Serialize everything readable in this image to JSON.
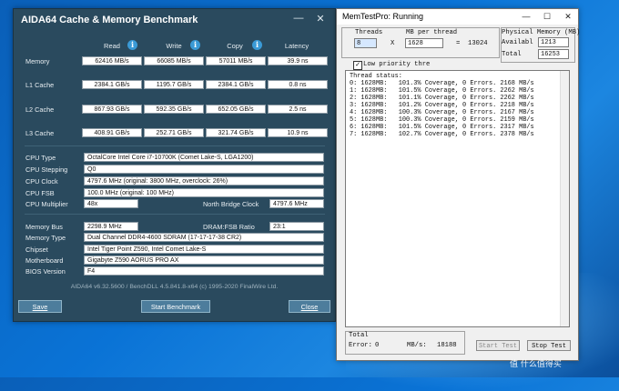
{
  "aida": {
    "title": "AIDA64 Cache & Memory Benchmark",
    "minimize": "—",
    "close": "✕",
    "columns": {
      "read": "Read",
      "write": "Write",
      "copy": "Copy",
      "latency": "Latency"
    },
    "info_glyph": "i",
    "rows": [
      {
        "label": "Memory",
        "read": "62416 MB/s",
        "write": "66085 MB/s",
        "copy": "57011 MB/s",
        "latency": "39.9 ns"
      },
      {
        "label": "L1 Cache",
        "read": "2384.1 GB/s",
        "write": "1195.7 GB/s",
        "copy": "2384.1 GB/s",
        "latency": "0.8 ns"
      },
      {
        "label": "L2 Cache",
        "read": "867.93 GB/s",
        "write": "592.35 GB/s",
        "copy": "652.05 GB/s",
        "latency": "2.5 ns"
      },
      {
        "label": "L3 Cache",
        "read": "408.91 GB/s",
        "write": "252.71 GB/s",
        "copy": "321.74 GB/s",
        "latency": "10.9 ns"
      }
    ],
    "cpu": {
      "type_label": "CPU Type",
      "type": "OctalCore Intel Core i7-10700K  (Comet Lake-S, LGA1200)",
      "stepping_label": "CPU Stepping",
      "stepping": "Q0",
      "clock_label": "CPU Clock",
      "clock": "4797.6 MHz  (original: 3800 MHz, overclock: 26%)",
      "fsb_label": "CPU FSB",
      "fsb": "100.0 MHz  (original: 100 MHz)",
      "multiplier_label": "CPU Multiplier",
      "multiplier": "48x",
      "nb_label": "North Bridge Clock",
      "nb": "4797.6 MHz"
    },
    "mem": {
      "bus_label": "Memory Bus",
      "bus": "2298.9 MHz",
      "ratio_label": "DRAM:FSB Ratio",
      "ratio": "23:1",
      "type_label": "Memory Type",
      "type": "Dual Channel DDR4-4600 SDRAM  (17-17-17-38 CR2)",
      "chipset_label": "Chipset",
      "chipset": "Intel Tiger Point Z590, Intel Comet Lake-S",
      "mobo_label": "Motherboard",
      "mobo": "Gigabyte Z590 AORUS PRO AX",
      "bios_label": "BIOS Version",
      "bios": "F4"
    },
    "footer": "AIDA64 v6.32.5600 / BenchDLL 4.5.841.8-x64  (c) 1995-2020 FinalWire Ltd.",
    "buttons": {
      "save": "Save",
      "start": "Start Benchmark",
      "close": "Close"
    }
  },
  "mtp": {
    "title": "MemTestPro: Running",
    "minimize": "—",
    "maximize": "☐",
    "close": "✕",
    "threads_label": "Threads",
    "threads": "8",
    "x": "X",
    "mbpt_label": "MB per thread",
    "mbpt": "1628",
    "eq": "=",
    "total_mb": "13024",
    "phys_label": "Physical Memory (MB)",
    "avail_label": "Availabl",
    "avail": "1213",
    "total_label": "Total",
    "total": "16253",
    "check_glyph": "✓",
    "low_priority": "Low priority thre",
    "status_header": "Thread status:",
    "threads_status": [
      "0: 1628MB:   101.3% Coverage, 0 Errors. 2168 MB/s",
      "1: 1628MB:   101.5% Coverage, 0 Errors. 2262 MB/s",
      "2: 1628MB:   101.1% Coverage, 0 Errors. 2262 MB/s",
      "3: 1628MB:   101.2% Coverage, 0 Errors. 2218 MB/s",
      "4: 1628MB:   100.3% Coverage, 0 Errors. 2167 MB/s",
      "5: 1628MB:   100.3% Coverage, 0 Errors. 2159 MB/s",
      "6: 1628MB:   101.5% Coverage, 0 Errors. 2317 MB/s",
      "7: 1628MB:   102.7% Coverage, 0 Errors. 2378 MB/s"
    ],
    "total_header": "Total",
    "error_label": "Error:",
    "error_value": "0",
    "mbs_label": "MB/s:",
    "mbs_value": "18188",
    "start_btn": "Start Test",
    "stop_btn": "Stop Test"
  },
  "watermark": "值 什么值得买"
}
